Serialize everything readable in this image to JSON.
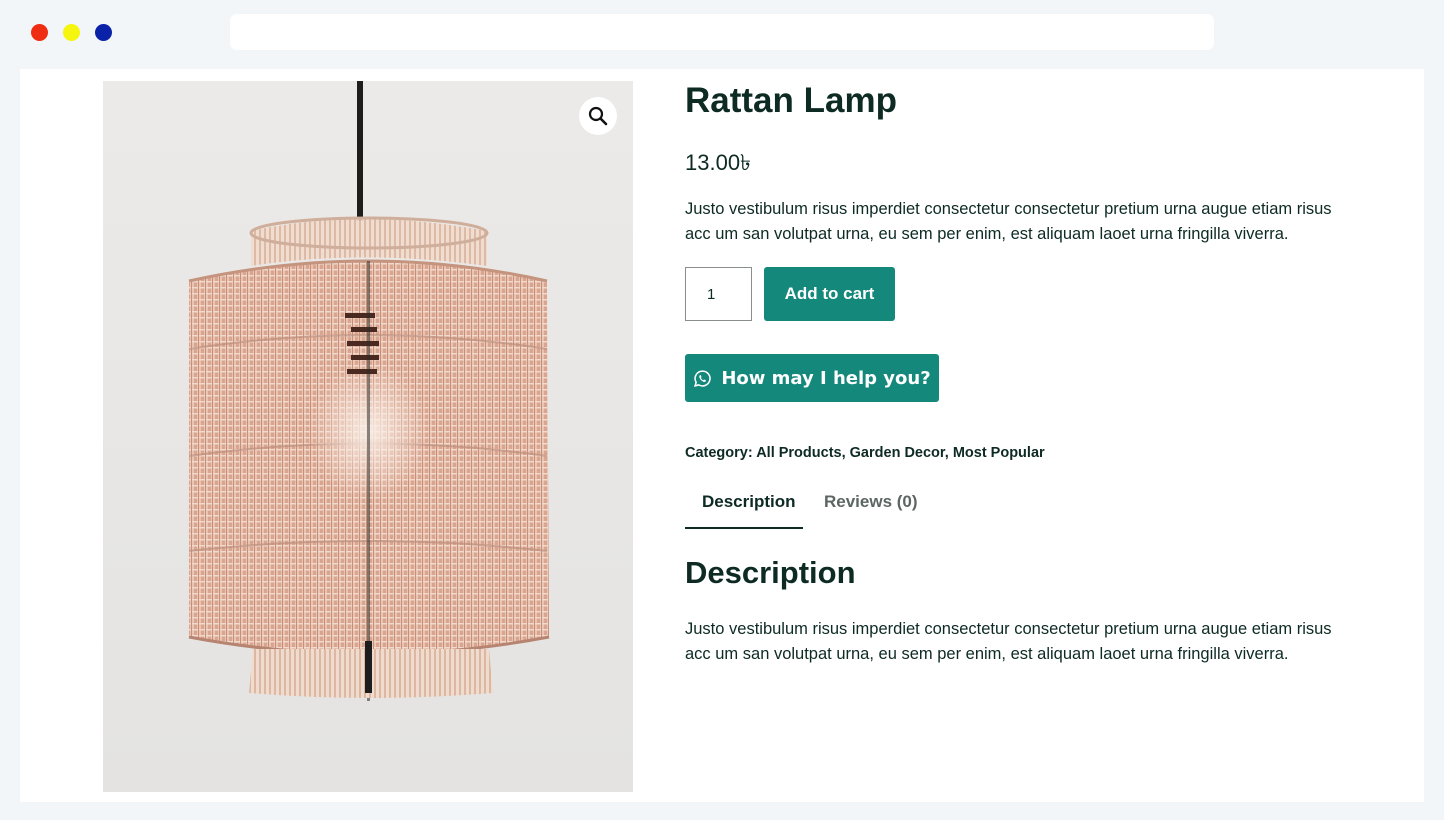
{
  "window": {
    "traffic_lights": [
      {
        "name": "close",
        "color": "#ef2d13"
      },
      {
        "name": "minimize",
        "color": "#f5f50f"
      },
      {
        "name": "maximize",
        "color": "#0a22a8"
      }
    ],
    "address_value": ""
  },
  "product": {
    "title": "Rattan Lamp",
    "price": "13.00৳",
    "short_description": "Justo vestibulum risus imperdiet consectetur consectetur pretium urna augue etiam risus acc um san volutpat urna, eu sem per enim, est aliquam laoet urna fringilla viverra.",
    "quantity": "1",
    "add_to_cart_label": "Add to cart",
    "help_button_label": "How may I help you?",
    "category_label": "Category:",
    "categories": [
      "All Products",
      "Garden Decor",
      "Most Popular"
    ],
    "category_separator": ", ",
    "image_icon": "zoom-icon"
  },
  "tabs": [
    {
      "label": "Description",
      "active": true
    },
    {
      "label": "Reviews (0)",
      "active": false
    }
  ],
  "description": {
    "heading": "Description",
    "text": "Justo vestibulum risus imperdiet consectetur consectetur pretium urna augue etiam risus acc um san volutpat urna, eu sem per enim, est aliquam laoet urna fringilla viverra."
  },
  "colors": {
    "accent": "#14897b",
    "text": "#0d2a23",
    "muted_tab": "#5c6662",
    "page_frame": "#f2f6f8"
  }
}
